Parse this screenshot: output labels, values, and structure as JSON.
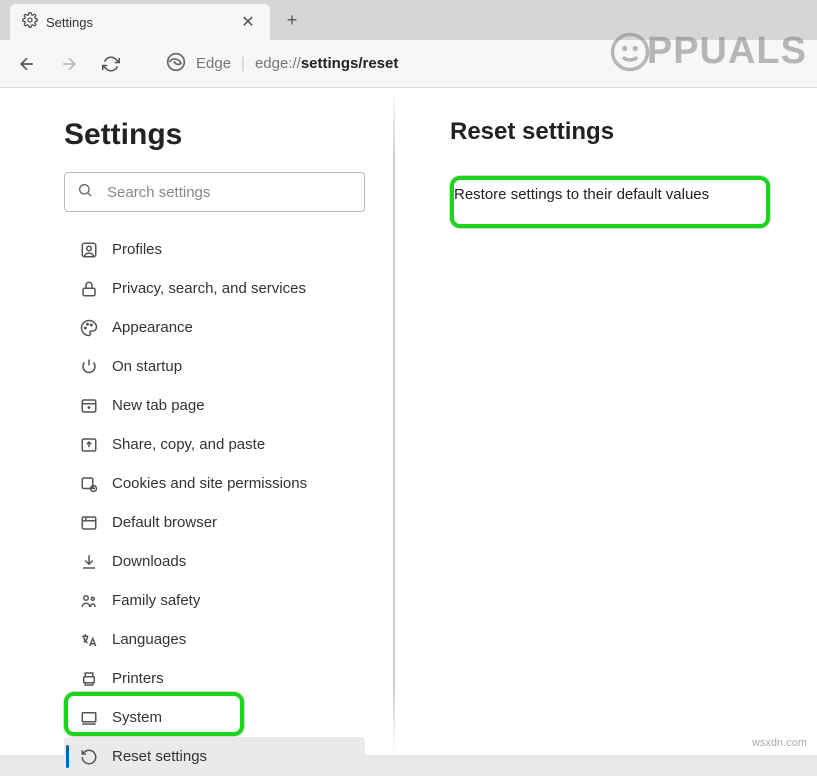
{
  "tab": {
    "title": "Settings"
  },
  "address": {
    "prefix": "Edge",
    "protocol": "edge://",
    "bold": "settings/reset"
  },
  "sidebar": {
    "heading": "Settings",
    "search_placeholder": "Search settings",
    "items": [
      {
        "label": "Profiles"
      },
      {
        "label": "Privacy, search, and services"
      },
      {
        "label": "Appearance"
      },
      {
        "label": "On startup"
      },
      {
        "label": "New tab page"
      },
      {
        "label": "Share, copy, and paste"
      },
      {
        "label": "Cookies and site permissions"
      },
      {
        "label": "Default browser"
      },
      {
        "label": "Downloads"
      },
      {
        "label": "Family safety"
      },
      {
        "label": "Languages"
      },
      {
        "label": "Printers"
      },
      {
        "label": "System"
      },
      {
        "label": "Reset settings"
      }
    ]
  },
  "main": {
    "heading": "Reset settings",
    "restore_label": "Restore settings to their default values"
  },
  "watermark": {
    "brand": "PPUALS",
    "site": "wsxdn.com"
  }
}
